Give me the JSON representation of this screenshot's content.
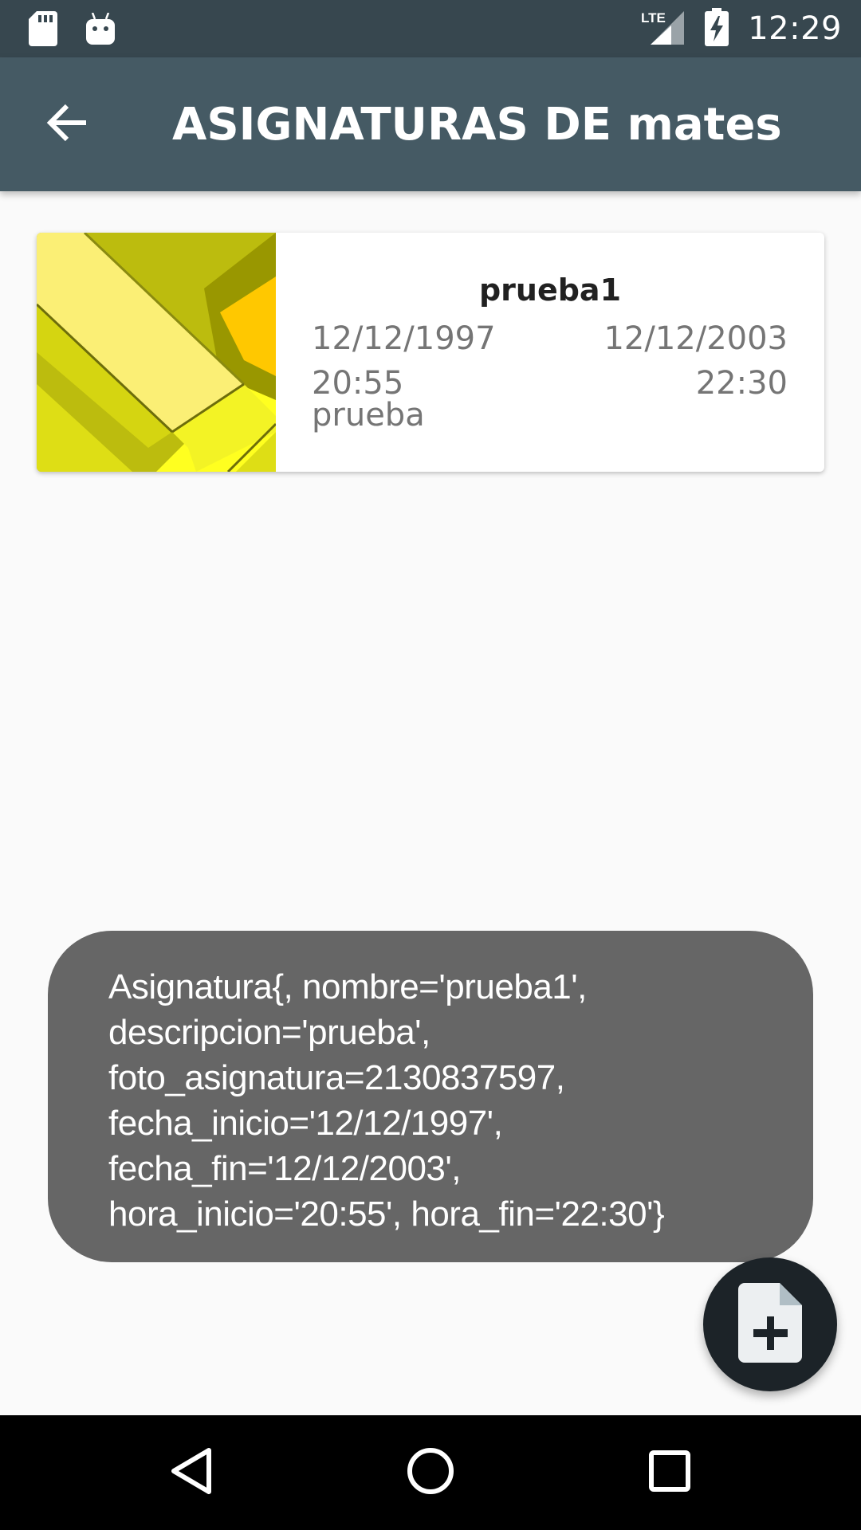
{
  "status_bar": {
    "time": "12:29",
    "network": "LTE",
    "icons": [
      "sd-card-icon",
      "android-debug-icon",
      "lte-signal-icon",
      "battery-charging-icon"
    ]
  },
  "toolbar": {
    "title": "ASIGNATURAS DE mates",
    "back_icon": "arrow-back-icon"
  },
  "card": {
    "name": "prueba1",
    "fecha_inicio": "12/12/1997",
    "fecha_fin": "12/12/2003",
    "hora_inicio": "20:55",
    "hora_fin": "22:30",
    "descripcion": "prueba"
  },
  "toast": {
    "lines": [
      "Asignatura{, nombre='prueba1',",
      "descripcion='prueba',",
      "foto_asignatura=2130837597,",
      "fecha_inicio='12/12/1997',",
      "fecha_fin='12/12/2003',",
      "hora_inicio='20:55', hora_fin='22:30'}"
    ]
  },
  "fab": {
    "icon": "add-document-icon"
  },
  "nav_bar": {
    "icons": [
      "back-triangle-icon",
      "home-circle-icon",
      "recents-square-icon"
    ]
  },
  "colors": {
    "status_bar": "#37474f",
    "toolbar": "#455a64",
    "toast": "#666666",
    "fab": "#1c2328"
  }
}
